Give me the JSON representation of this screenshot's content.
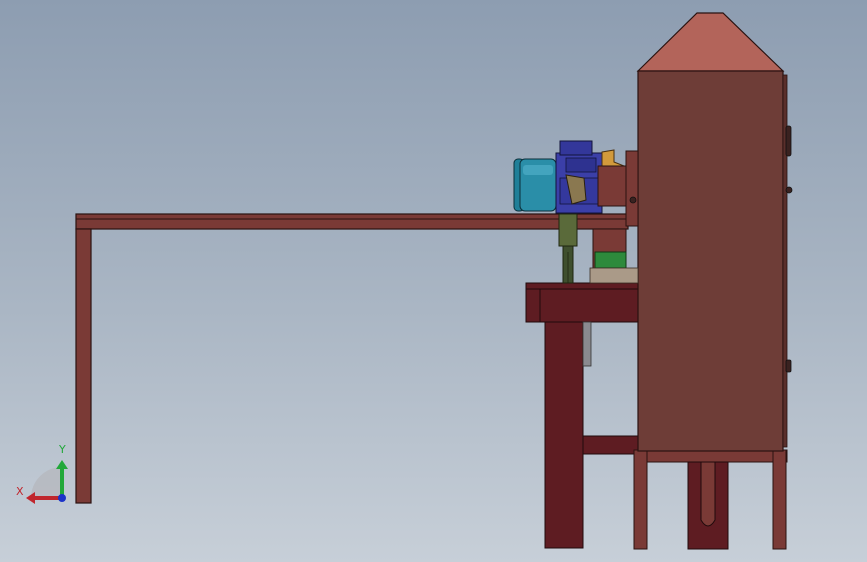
{
  "viewport": {
    "background_top": "#8d9db1",
    "background_bottom": "#c7cfd8"
  },
  "model": {
    "frame_color": "#7a3a36",
    "cabinet_color": "#6e3d37",
    "roof_color": "#b3645a",
    "base_color": "#5e1c22",
    "motor_color": "#2a8ea8",
    "gearbox_color": "#3b3fa8",
    "bracket_color": "#d29a3c",
    "guide_color": "#5a6a3a",
    "plate_color": "#2d8a3c"
  },
  "triad": {
    "x_label": "X",
    "y_label": "Y",
    "x_color": "#c0262d",
    "y_color": "#21a83a",
    "origin_color": "#1b33c9"
  }
}
